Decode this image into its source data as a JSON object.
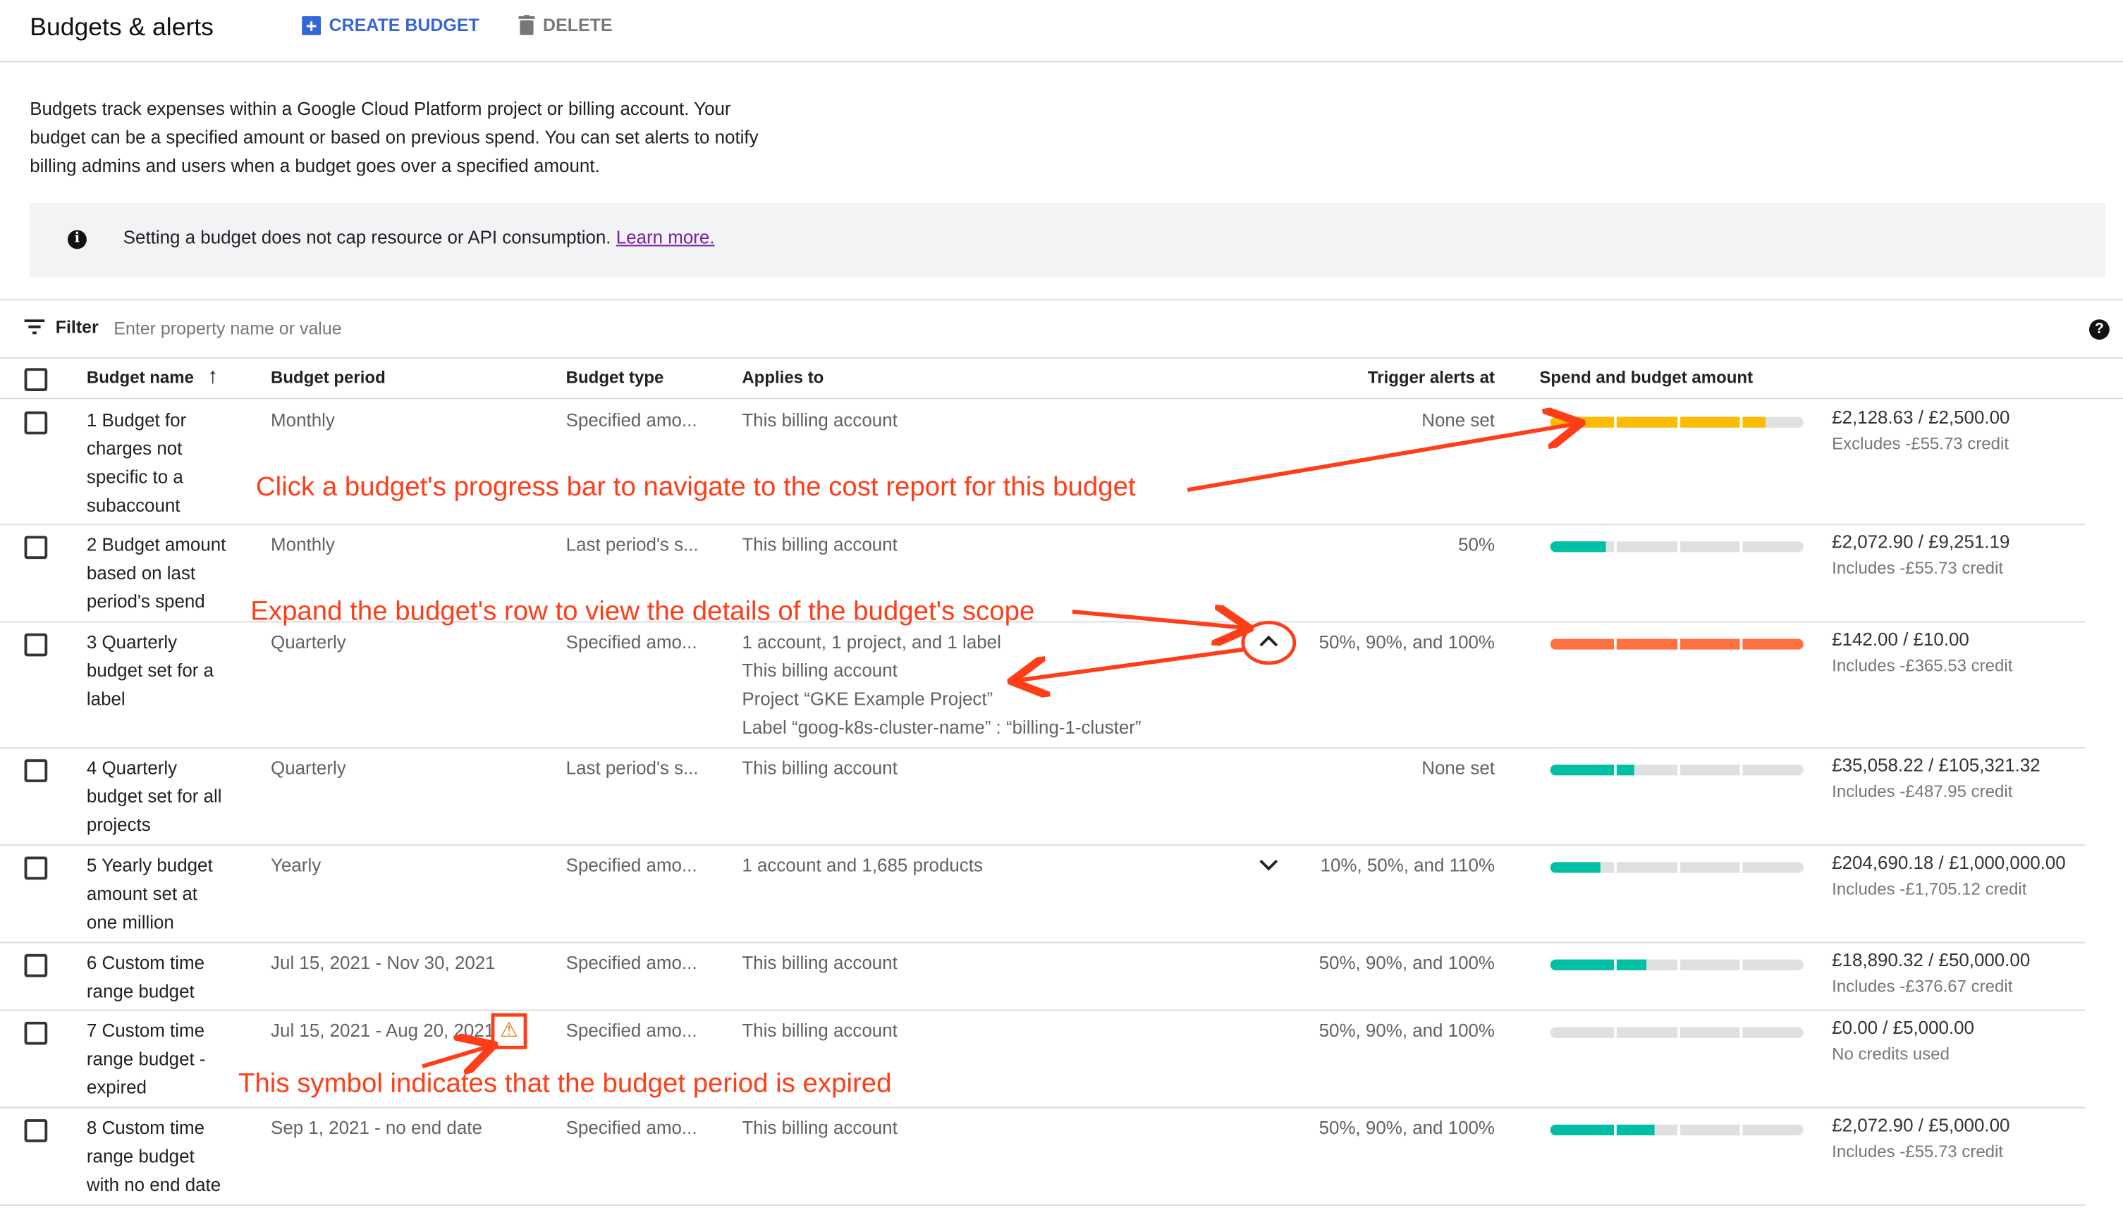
{
  "header": {
    "title": "Budgets & alerts",
    "create_label": "CREATE BUDGET",
    "delete_label": "DELETE"
  },
  "description": "Budgets track expenses within a Google Cloud Platform project or billing account. Your budget can be a specified amount or based on previous spend. You can set alerts to notify billing admins and users when a budget goes over a specified amount.",
  "info": {
    "text": "Setting a budget does not cap resource or API consumption.",
    "link": "Learn more."
  },
  "filter": {
    "label": "Filter",
    "placeholder": "Enter property name or value"
  },
  "columns": {
    "name": "Budget name",
    "period": "Budget period",
    "type": "Budget type",
    "applies": "Applies to",
    "trigger": "Trigger alerts at",
    "spend": "Spend and budget amount"
  },
  "colors": {
    "yellow": "#fbbc04",
    "teal": "#00bfa5",
    "orange": "#ff7043",
    "accent": "#3367d6",
    "annotation": "#ff3d17"
  },
  "rows": [
    {
      "name": [
        "1 Budget for",
        "charges not",
        "specific to a",
        "subaccount"
      ],
      "period": "Monthly",
      "type": "Specified amo...",
      "applies": [
        "This billing account"
      ],
      "trigger": "None set",
      "progress": 0.85,
      "bar_color": "yellow",
      "amount": "£2,128.63 / £2,500.00",
      "credit": "Excludes -£55.73 credit"
    },
    {
      "name": [
        "2 Budget amount",
        "based on last",
        "period's spend"
      ],
      "period": "Monthly",
      "type": "Last period's s...",
      "applies": [
        "This billing account"
      ],
      "trigger": "50%",
      "progress": 0.22,
      "bar_color": "teal",
      "amount": "£2,072.90 / £9,251.19",
      "credit": "Includes -£55.73 credit"
    },
    {
      "name": [
        "3 Quarterly",
        "budget set for a",
        "label"
      ],
      "period": "Quarterly",
      "type": "Specified amo...",
      "applies": [
        "1 account, 1 project, and 1 label",
        "This billing account",
        "Project “GKE Example Project”",
        "Label “goog-k8s-cluster-name” : “billing-1-cluster”"
      ],
      "expand": "up",
      "trigger": "50%, 90%, and 100%",
      "progress": 1.0,
      "bar_color": "orange",
      "amount": "£142.00 / £10.00",
      "credit": "Includes -£365.53 credit"
    },
    {
      "name": [
        "4 Quarterly",
        "budget set for all",
        "projects"
      ],
      "period": "Quarterly",
      "type": "Last period's s...",
      "applies": [
        "This billing account"
      ],
      "trigger": "None set",
      "progress": 0.33,
      "bar_color": "teal",
      "amount": "£35,058.22 / £105,321.32",
      "credit": "Includes -£487.95 credit"
    },
    {
      "name": [
        "5 Yearly budget",
        "amount set at",
        "one million"
      ],
      "period": "Yearly",
      "type": "Specified amo...",
      "applies": [
        "1 account and 1,685 products"
      ],
      "expand": "down",
      "trigger": "10%, 50%, and 110%",
      "progress": 0.2,
      "bar_color": "teal",
      "amount": "£204,690.18 / £1,000,000.00",
      "credit": "Includes -£1,705.12 credit"
    },
    {
      "name": [
        "6 Custom time",
        "range budget"
      ],
      "period": "Jul 15, 2021 - Nov 30, 2021",
      "type": "Specified amo...",
      "applies": [
        "This billing account"
      ],
      "trigger": "50%, 90%, and 100%",
      "progress": 0.38,
      "bar_color": "teal",
      "amount": "£18,890.32 / £50,000.00",
      "credit": "Includes -£376.67 credit"
    },
    {
      "name": [
        "7 Custom time",
        "range budget -",
        "expired"
      ],
      "period": "Jul 15, 2021 - Aug 20, 2021",
      "expired": true,
      "type": "Specified amo...",
      "applies": [
        "This billing account"
      ],
      "trigger": "50%, 90%, and 100%",
      "progress": 0.0,
      "bar_color": "teal",
      "amount": "£0.00 / £5,000.00",
      "credit": "No credits used"
    },
    {
      "name": [
        "8 Custom time",
        "range budget",
        "with no end date"
      ],
      "period": "Sep 1, 2021 - no end date",
      "type": "Specified amo...",
      "applies": [
        "This billing account"
      ],
      "trigger": "50%, 90%, and 100%",
      "progress": 0.41,
      "bar_color": "teal",
      "amount": "£2,072.90 / £5,000.00",
      "credit": "Includes -£55.73 credit"
    }
  ],
  "annotations": {
    "progress": "Click a budget's progress bar to navigate to the cost report for this budget",
    "expand": "Expand the budget's row to view the details of the budget's scope",
    "expired": "This symbol indicates that the budget period is expired"
  }
}
